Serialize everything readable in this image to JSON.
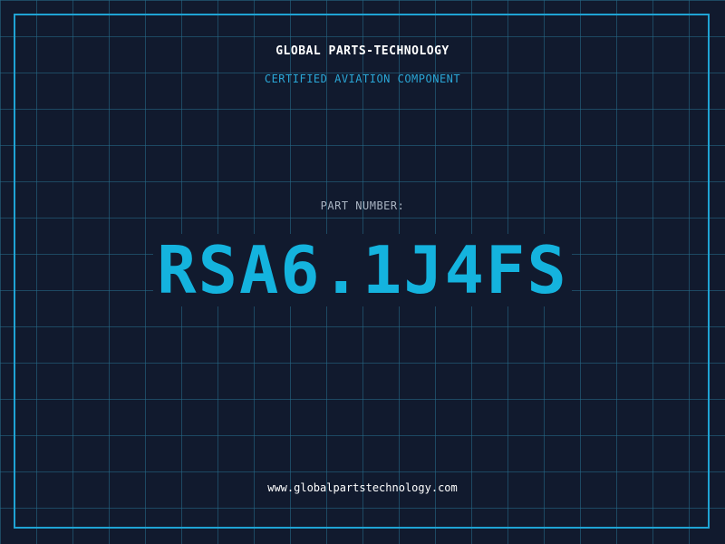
{
  "header": {
    "brand": "GLOBAL PARTS-TECHNOLOGY",
    "subtitle": "CERTIFIED AVIATION COMPONENT"
  },
  "part": {
    "label": "PART NUMBER:",
    "number": "RSA6.1J4FS"
  },
  "footer": {
    "url": "www.globalpartstechnology.com"
  },
  "colors": {
    "background": "#111a2e",
    "grid": "#266e8c",
    "frame": "#1fa3d4",
    "accent": "#14b3de",
    "label": "#a9b4c2",
    "text": "#ffffff"
  }
}
